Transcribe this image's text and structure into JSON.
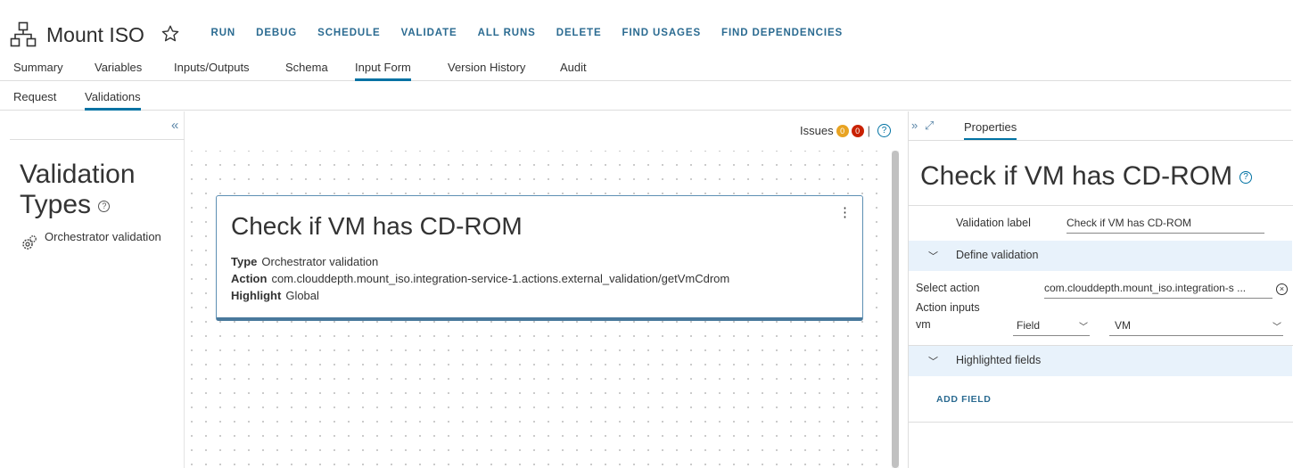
{
  "header": {
    "title": "Mount ISO",
    "app_icon": "workflow-hierarchy-icon",
    "favorite_icon": "star-icon",
    "actions": [
      "RUN",
      "DEBUG",
      "SCHEDULE",
      "VALIDATE",
      "ALL RUNS",
      "DELETE",
      "FIND USAGES",
      "FIND DEPENDENCIES"
    ]
  },
  "tabs": [
    "Summary",
    "Variables",
    "Inputs/Outputs",
    "Schema",
    "Input Form",
    "Version History",
    "Audit"
  ],
  "active_tab": "Input Form",
  "subtabs": [
    "Request",
    "Validations"
  ],
  "active_subtab": "Validations",
  "left_panel": {
    "title": "Validation Types",
    "help_glyph": "?",
    "items": [
      {
        "label": "Orchestrator validation",
        "icon": "gears-icon"
      }
    ]
  },
  "canvas": {
    "issues": {
      "label": "Issues",
      "warnings": "0",
      "errors": "0",
      "help_glyph": "?"
    },
    "card": {
      "title": "Check if VM has CD-ROM",
      "menu_glyph": "⋮",
      "rows": [
        {
          "key": "Type",
          "value": "Orchestrator validation"
        },
        {
          "key": "Action",
          "value": "com.clouddepth.mount_iso.integration-service-1.actions.external_validation/getVmCdrom"
        },
        {
          "key": "Highlight",
          "value": "Global"
        }
      ]
    }
  },
  "right_panel": {
    "tab": "Properties",
    "title": "Check if VM has CD-ROM",
    "help_glyph": "?",
    "validation_label": {
      "label": "Validation label",
      "value": "Check if VM has CD-ROM"
    },
    "define_section": "Define validation",
    "select_action": {
      "label": "Select action",
      "value": "com.clouddepth.mount_iso.integration-s ..."
    },
    "action_inputs_label": "Action inputs",
    "vm_input": {
      "label": "vm",
      "type": "Field",
      "value": "VM"
    },
    "highlighted_section": "Highlighted fields",
    "add_field": "ADD FIELD"
  },
  "colors": {
    "accent": "#0072a3",
    "action_text": "#2b6b91",
    "warning_badge": "#e8a322",
    "error_badge": "#c92100",
    "section_bg": "#e8f2fb"
  }
}
